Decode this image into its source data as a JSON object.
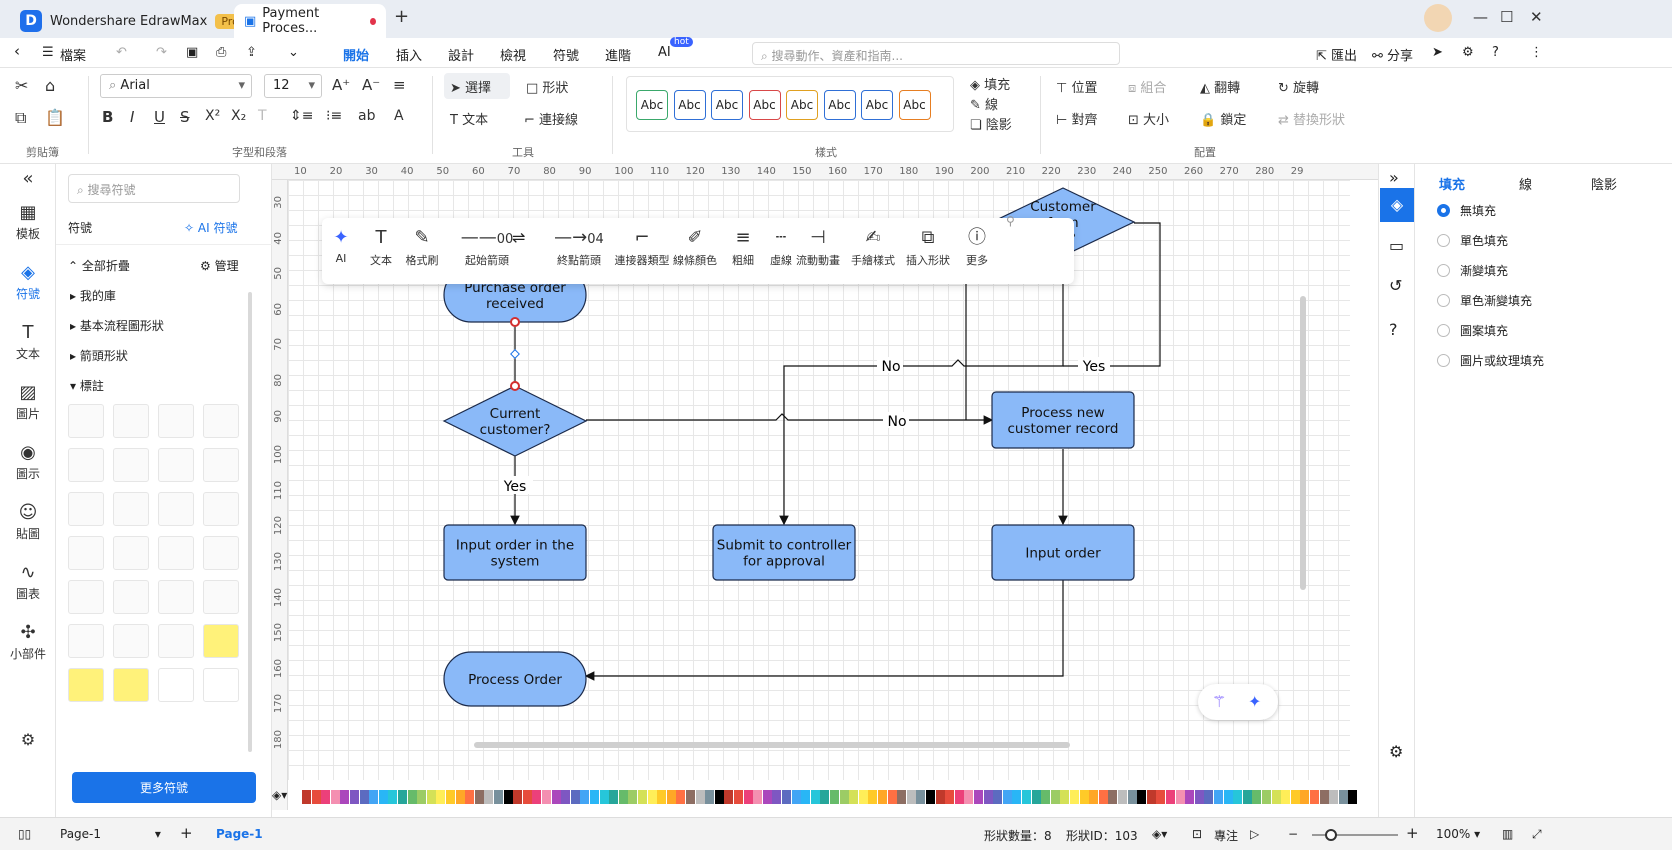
{
  "titlebar": {
    "app_name": "Wondershare EdrawMax",
    "pro_badge": "Pro",
    "doc_tab": "Payment Proces...",
    "new_tab": "+"
  },
  "menubar": {
    "file": "檔案",
    "tabs": [
      "開始",
      "插入",
      "設計",
      "檢視",
      "符號",
      "進階",
      "AI"
    ],
    "ai_badge": "hot",
    "search_placeholder": "搜尋動作、資產和指南...",
    "export": "匯出",
    "share": "分享"
  },
  "ribbon": {
    "font_name": "Arial",
    "font_size": "12",
    "select": "選擇",
    "shape": "形狀",
    "text": "文本",
    "connector": "連接線",
    "style_sample": "Abc",
    "fill": "填充",
    "line": "線",
    "shadow": "陰影",
    "position": "位置",
    "group": "組合",
    "flip": "翻轉",
    "rotate": "旋轉",
    "align": "對齊",
    "size": "大小",
    "lock": "鎖定",
    "replace_shape": "替換形狀",
    "groups": {
      "clipboard": "剪貼簿",
      "font_paragraph": "字型和段落",
      "tools": "工具",
      "styles": "樣式",
      "arrange": "配置"
    },
    "style_colors": [
      "#3aa86b",
      "#2f6fd6",
      "#2f6fd6",
      "#d84848",
      "#e0a020",
      "#2f6fd6",
      "#2f6fd6",
      "#e67e22"
    ]
  },
  "leftnav": {
    "items": [
      {
        "label": "模板",
        "icon": "template-icon"
      },
      {
        "label": "符號",
        "icon": "symbol-icon"
      },
      {
        "label": "文本",
        "icon": "text-icon"
      },
      {
        "label": "圖片",
        "icon": "image-icon"
      },
      {
        "label": "圖示",
        "icon": "icon-icon"
      },
      {
        "label": "貼圖",
        "icon": "sticker-icon"
      },
      {
        "label": "圖表",
        "icon": "chart-icon"
      },
      {
        "label": "小部件",
        "icon": "widget-icon"
      }
    ]
  },
  "sympanel": {
    "search_placeholder": "搜尋符號",
    "title": "符號",
    "ai_symbol": "AI 符號",
    "collapse_all": "全部折疊",
    "manage": "管理",
    "categories": [
      "我的庫",
      "基本流程圖形狀",
      "箭頭形狀",
      "標註"
    ],
    "more_symbols": "更多符號"
  },
  "ruler": {
    "top": [
      "10",
      "20",
      "30",
      "40",
      "50",
      "60",
      "70",
      "80",
      "90",
      "100",
      "110",
      "120",
      "130",
      "140",
      "150",
      "160",
      "170",
      "180",
      "190",
      "200",
      "210",
      "220",
      "230",
      "240",
      "250",
      "260",
      "270",
      "280",
      "29"
    ],
    "left": [
      "30",
      "40",
      "50",
      "60",
      "70",
      "80",
      "90",
      "100",
      "110",
      "120",
      "130",
      "140",
      "150",
      "160",
      "170",
      "180"
    ]
  },
  "floatbar": {
    "items": [
      "AI",
      "文本",
      "格式刷",
      "起始箭頭",
      "終點箭頭",
      "連接器類型",
      "線條顏色",
      "粗細",
      "虛線",
      "流動動畫",
      "手繪樣式",
      "插入形狀",
      "更多"
    ],
    "start_arrow_value": "00",
    "end_arrow_value": "04"
  },
  "diagram": {
    "nodes": {
      "purchase": "Purchase  order|received",
      "current": "Current|customer?",
      "us": "Customer|from|US?",
      "newrec": "Process new|customer  record",
      "input_sys": "Input order in the|system",
      "submit": "Submit to controller|for approval",
      "input_order": "Input order",
      "process": "Process Order"
    },
    "labels": {
      "yes1": "Yes",
      "no1": "No",
      "no2": "No",
      "yes2": "Yes"
    },
    "fill_color": "#8ab9f8",
    "stroke_color": "#1b2a4a"
  },
  "rightpanel": {
    "tabs": [
      "填充",
      "線",
      "陰影"
    ],
    "options": [
      "無填充",
      "單色填充",
      "漸變填充",
      "單色漸變填充",
      "圖案填充",
      "圖片或紋理填充"
    ],
    "selected": "無填充"
  },
  "statusbar": {
    "page_select": "Page-1",
    "page_tab": "Page-1",
    "shape_count": "形狀數量：8",
    "shape_id": "形狀ID：103",
    "focus": "專注",
    "zoom": "100%"
  },
  "palette": [
    "#c0392b",
    "#e74c3c",
    "#ec407a",
    "#f48fb1",
    "#ab47bc",
    "#7e57c2",
    "#5c6bc0",
    "#42a5f5",
    "#29b6f6",
    "#26c6da",
    "#26a69a",
    "#66bb6a",
    "#9ccc65",
    "#d4e157",
    "#ffee58",
    "#ffca28",
    "#ffa726",
    "#ff7043",
    "#8d6e63",
    "#bdbdbd",
    "#78909c",
    "#000000"
  ]
}
